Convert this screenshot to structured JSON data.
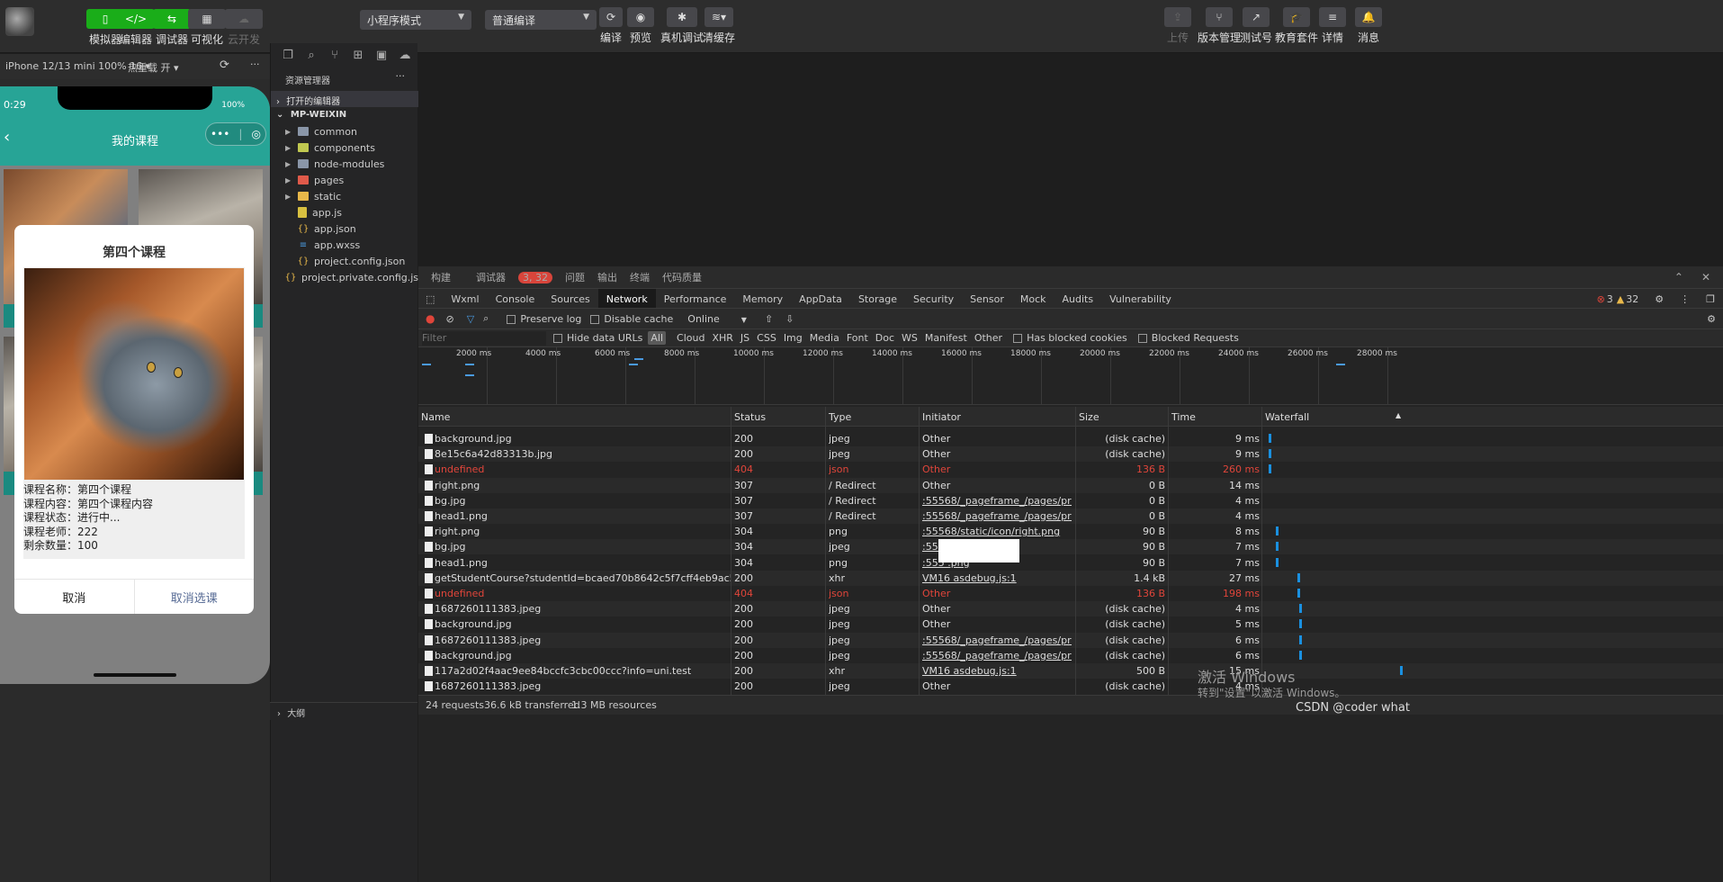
{
  "toolbar": {
    "left_buttons": [
      "模拟器",
      "编辑器",
      "调试器",
      "可视化",
      "云开发"
    ],
    "mode_select": "小程序模式",
    "compile_select": "普通编译",
    "mid_buttons": [
      "编译",
      "预览",
      "真机调试",
      "清缓存"
    ],
    "right_buttons": [
      "上传",
      "版本管理",
      "测试号",
      "教育套件",
      "详情",
      "消息"
    ]
  },
  "simulator": {
    "device": "iPhone 12/13 mini 100% 16 ▾",
    "hot_reload": "热重载 开 ▾",
    "time": "0:29",
    "battery": "100%",
    "page_title": "我的课程",
    "modal": {
      "title": "第四个课程",
      "lines": [
        "课程名称：第四个课程",
        "课程内容：第四个课程内容",
        "课程状态：进行中...",
        "课程老师：222",
        "剩余数量：100"
      ],
      "cancel": "取消",
      "confirm": "取消选课"
    }
  },
  "explorer": {
    "title": "资源管理器",
    "open_editors": "打开的编辑器",
    "project": "MP-WEIXIN",
    "items": [
      {
        "label": "common",
        "type": "folder"
      },
      {
        "label": "components",
        "type": "folder"
      },
      {
        "label": "node-modules",
        "type": "folder"
      },
      {
        "label": "pages",
        "type": "folder"
      },
      {
        "label": "static",
        "type": "folder"
      },
      {
        "label": "app.js",
        "type": "js"
      },
      {
        "label": "app.json",
        "type": "json"
      },
      {
        "label": "app.wxss",
        "type": "wxss"
      },
      {
        "label": "project.config.json",
        "type": "json"
      },
      {
        "label": "project.private.config.js...",
        "type": "json"
      }
    ],
    "outline": "大纲"
  },
  "devtools": {
    "top_tabs": [
      "构建",
      "调试器",
      "问题",
      "输出",
      "终端",
      "代码质量"
    ],
    "debug_badge": "3, 32",
    "tabs": [
      "Wxml",
      "Console",
      "Sources",
      "Network",
      "Performance",
      "Memory",
      "AppData",
      "Storage",
      "Security",
      "Sensor",
      "Mock",
      "Audits",
      "Vulnerability"
    ],
    "errors": "3",
    "warnings": "32",
    "toolbar": {
      "preserve_log": "Preserve log",
      "disable_cache": "Disable cache",
      "throttle": "Online"
    },
    "filter": {
      "placeholder": "Filter",
      "hide_data_urls": "Hide data URLs",
      "types": [
        "All",
        "Cloud",
        "XHR",
        "JS",
        "CSS",
        "Img",
        "Media",
        "Font",
        "Doc",
        "WS",
        "Manifest",
        "Other"
      ],
      "blocked_cookies": "Has blocked cookies",
      "blocked_requests": "Blocked Requests"
    },
    "timeline_labels": [
      "2000 ms",
      "4000 ms",
      "6000 ms",
      "8000 ms",
      "10000 ms",
      "12000 ms",
      "14000 ms",
      "16000 ms",
      "18000 ms",
      "20000 ms",
      "22000 ms",
      "24000 ms",
      "26000 ms",
      "28000 ms"
    ],
    "columns": [
      "Name",
      "Status",
      "Type",
      "Initiator",
      "Size",
      "Time",
      "Waterfall"
    ],
    "rows": [
      {
        "name": "background.jpg",
        "status": "200",
        "type": "jpeg",
        "initiator": "Other",
        "size": "(disk cache)",
        "time": "9 ms"
      },
      {
        "name": "8e15c6a42d83313b.jpg",
        "status": "200",
        "type": "jpeg",
        "initiator": "Other",
        "size": "(disk cache)",
        "time": "9 ms"
      },
      {
        "name": "undefined",
        "status": "404",
        "type": "json",
        "initiator": "Other",
        "size": "136 B",
        "time": "260 ms",
        "error": true
      },
      {
        "name": "right.png",
        "status": "307",
        "type": "/ Redirect",
        "initiator": "Other",
        "size": "0 B",
        "time": "14 ms"
      },
      {
        "name": "bg.jpg",
        "status": "307",
        "type": "/ Redirect",
        "initiator": ":55568/_pageframe_/pages/profile...",
        "size": "0 B",
        "time": "4 ms"
      },
      {
        "name": "head1.png",
        "status": "307",
        "type": "/ Redirect",
        "initiator": ":55568/_pageframe_/pages/profile...",
        "size": "0 B",
        "time": "4 ms"
      },
      {
        "name": "right.png",
        "status": "304",
        "type": "png",
        "initiator": ":55568/static/icon/right.png",
        "size": "90 B",
        "time": "8 ms"
      },
      {
        "name": "bg.jpg",
        "status": "304",
        "type": "jpeg",
        "initiator": ":5556",
        "size": "90 B",
        "time": "7 ms"
      },
      {
        "name": "head1.png",
        "status": "304",
        "type": "png",
        "initiator": ":555 .png",
        "size": "90 B",
        "time": "7 ms"
      },
      {
        "name": "getStudentCourse?studentId=bcaed70b8642c5f7cff4eb9ac58d6750&info...",
        "status": "200",
        "type": "xhr",
        "initiator": "VM16 asdebug.js:1",
        "size": "1.4 kB",
        "time": "27 ms"
      },
      {
        "name": "undefined",
        "status": "404",
        "type": "json",
        "initiator": "Other",
        "size": "136 B",
        "time": "198 ms",
        "error": true
      },
      {
        "name": "1687260111383.jpeg",
        "status": "200",
        "type": "jpeg",
        "initiator": "Other",
        "size": "(disk cache)",
        "time": "4 ms"
      },
      {
        "name": "background.jpg",
        "status": "200",
        "type": "jpeg",
        "initiator": "Other",
        "size": "(disk cache)",
        "time": "5 ms"
      },
      {
        "name": "1687260111383.jpeg",
        "status": "200",
        "type": "jpeg",
        "initiator": ":55568/_pageframe_/pages/profile...",
        "size": "(disk cache)",
        "time": "6 ms"
      },
      {
        "name": "background.jpg",
        "status": "200",
        "type": "jpeg",
        "initiator": ":55568/_pageframe_/pages/profile...",
        "size": "(disk cache)",
        "time": "6 ms"
      },
      {
        "name": "117a2d02f4aac9ee84bccfc3cbc00ccc?info=uni.test",
        "status": "200",
        "type": "xhr",
        "initiator": "VM16 asdebug.js:1",
        "size": "500 B",
        "time": "15 ms"
      },
      {
        "name": "1687260111383.jpeg",
        "status": "200",
        "type": "jpeg",
        "initiator": "Other",
        "size": "(disk cache)",
        "time": "4 ms"
      }
    ],
    "status": {
      "requests": "24 requests",
      "transferred": "36.6 kB transferred",
      "resources": "1.3 MB resources"
    }
  },
  "watermark": {
    "line1": "激活 Windows",
    "line2": "转到\"设置\"以激活 Windows。"
  },
  "csdn": "CSDN @coder what"
}
